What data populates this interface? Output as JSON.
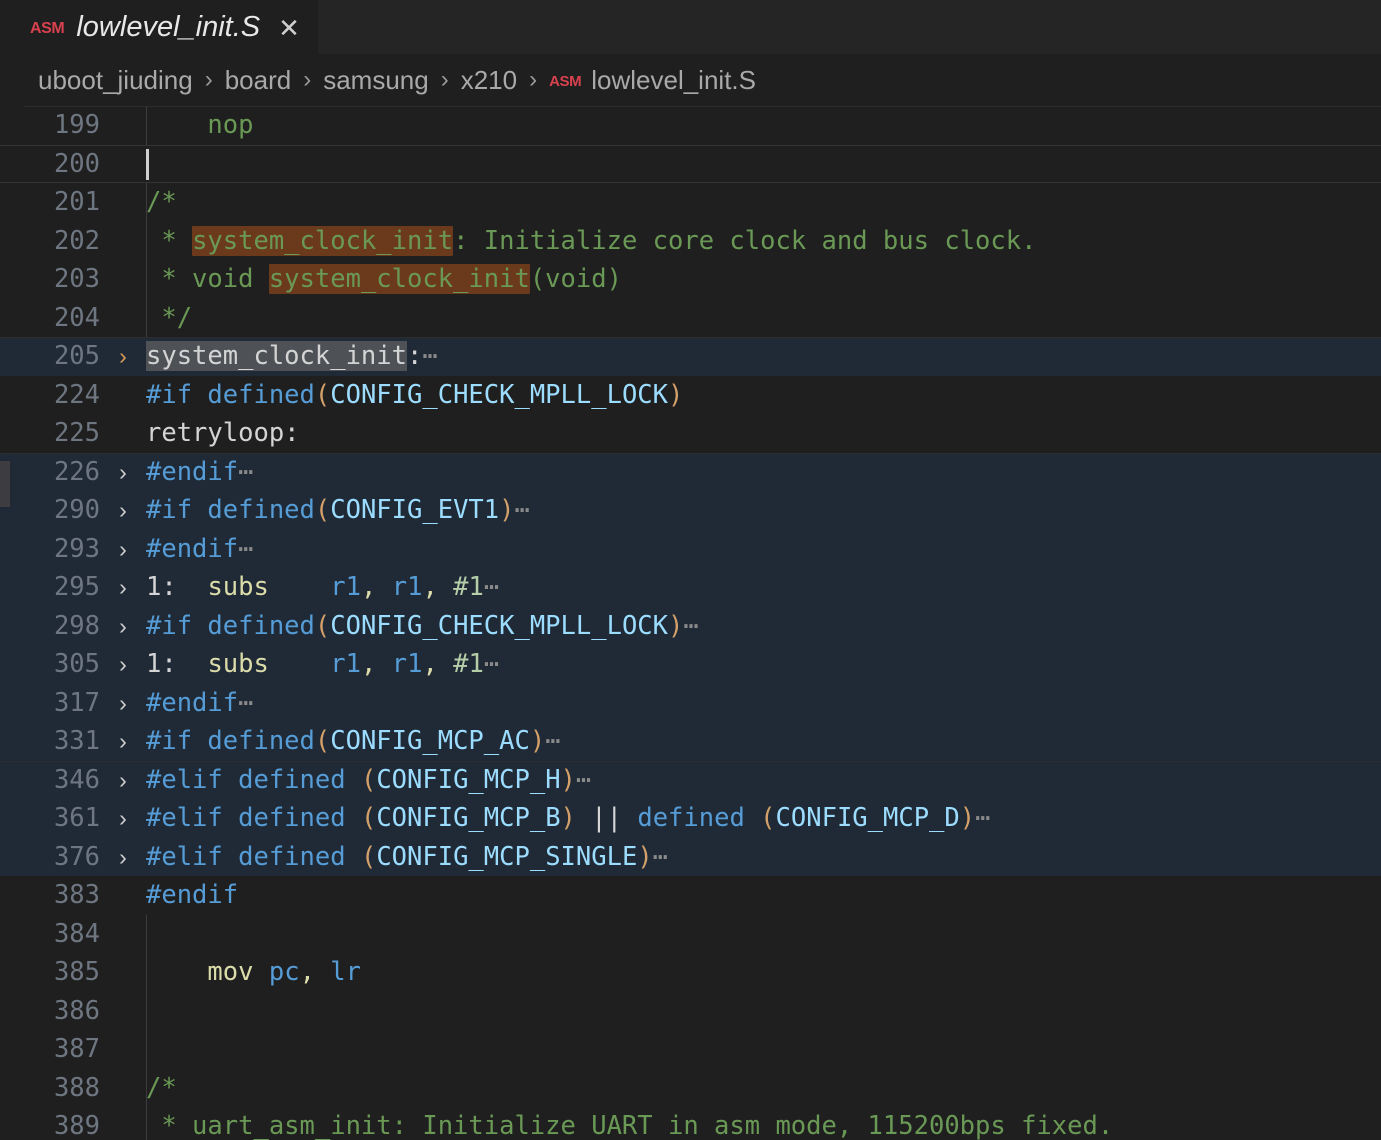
{
  "window": {
    "background": "#1f1f1f"
  },
  "tab": {
    "icon": "ASM",
    "icon_name": "asm-file-icon",
    "label": "lowlevel_init.S",
    "close": "✕",
    "active": true
  },
  "breadcrumb": {
    "separator": "›",
    "items": [
      {
        "label": "uboot_jiuding"
      },
      {
        "label": "board"
      },
      {
        "label": "samsung"
      },
      {
        "label": "x210"
      }
    ],
    "file": {
      "icon": "ASM",
      "label": "lowlevel_init.S"
    }
  },
  "colors": {
    "editor_background": "#1f1f1f",
    "tabbar_background": "#252526",
    "folded_region_background": "#1f2a36",
    "search_match_highlight": "#6b3a1c",
    "selection_highlight": "#4e5257",
    "line_number": "#6e7681",
    "comment": "#6a9955",
    "preprocessor": "#569cd6",
    "macro_name": "#9cdcfe",
    "instruction": "#dcdcaa",
    "register": "#569cd6",
    "number": "#b5cea8",
    "fold_chevron_active": "#d99a57",
    "asm_icon": "#d9414f"
  },
  "editor": {
    "fold_chevron": "›",
    "ellipsis": "⋯",
    "lines": [
      {
        "number": "199",
        "fold": false,
        "folded_bg": false,
        "current": false,
        "indent_guide": true,
        "tokens": [
          {
            "text": "    nop",
            "cls": "t-comment"
          }
        ]
      },
      {
        "number": "200",
        "fold": false,
        "folded_bg": false,
        "current": true,
        "indent_guide": false,
        "cursor": true,
        "tokens": []
      },
      {
        "number": "201",
        "fold": false,
        "folded_bg": false,
        "current": false,
        "indent_guide": true,
        "tokens": [
          {
            "text": "/*",
            "cls": "t-comment"
          }
        ]
      },
      {
        "number": "202",
        "fold": false,
        "folded_bg": false,
        "current": false,
        "indent_guide": true,
        "tokens": [
          {
            "text": " * ",
            "cls": "t-comment"
          },
          {
            "text": "system_clock_init",
            "cls": "t-comment",
            "hl": "match"
          },
          {
            "text": ": Initialize core clock and bus clock.",
            "cls": "t-comment"
          }
        ]
      },
      {
        "number": "203",
        "fold": false,
        "folded_bg": false,
        "current": false,
        "indent_guide": true,
        "tokens": [
          {
            "text": " * void ",
            "cls": "t-comment"
          },
          {
            "text": "system_clock_init",
            "cls": "t-comment",
            "hl": "match"
          },
          {
            "text": "(void)",
            "cls": "t-comment"
          }
        ]
      },
      {
        "number": "204",
        "fold": false,
        "folded_bg": false,
        "current": false,
        "indent_guide": true,
        "tokens": [
          {
            "text": " */",
            "cls": "t-comment"
          }
        ]
      },
      {
        "number": "205",
        "fold": true,
        "fold_accent": true,
        "folded_bg": true,
        "fold_top": true,
        "current": false,
        "indent_guide": false,
        "tokens": [
          {
            "text": "system_clock_init",
            "cls": "t-plain",
            "hl": "sel"
          },
          {
            "text": ":",
            "cls": "t-plain"
          },
          {
            "text": "⋯",
            "cls": "t-ell"
          }
        ]
      },
      {
        "number": "224",
        "fold": false,
        "folded_bg": false,
        "current": false,
        "indent_guide": false,
        "tokens": [
          {
            "text": "#if",
            "cls": "t-pre"
          },
          {
            "text": " ",
            "cls": "t-plain"
          },
          {
            "text": "defined",
            "cls": "t-pre"
          },
          {
            "text": "(",
            "cls": "t-paren"
          },
          {
            "text": "CONFIG_CHECK_MPLL_LOCK",
            "cls": "t-macro"
          },
          {
            "text": ")",
            "cls": "t-paren"
          }
        ]
      },
      {
        "number": "225",
        "fold": false,
        "folded_bg": false,
        "current": false,
        "indent_guide": false,
        "tokens": [
          {
            "text": "retryloop:",
            "cls": "t-plain"
          }
        ]
      },
      {
        "number": "226",
        "fold": true,
        "folded_bg": true,
        "fold_top": true,
        "current": false,
        "indent_guide": false,
        "tokens": [
          {
            "text": "#endif",
            "cls": "t-pre"
          },
          {
            "text": "⋯",
            "cls": "t-ell"
          }
        ]
      },
      {
        "number": "290",
        "fold": true,
        "folded_bg": true,
        "current": false,
        "indent_guide": false,
        "tokens": [
          {
            "text": "#if",
            "cls": "t-pre"
          },
          {
            "text": " ",
            "cls": "t-plain"
          },
          {
            "text": "defined",
            "cls": "t-pre"
          },
          {
            "text": "(",
            "cls": "t-paren"
          },
          {
            "text": "CONFIG_EVT1",
            "cls": "t-macro"
          },
          {
            "text": ")",
            "cls": "t-paren"
          },
          {
            "text": "⋯",
            "cls": "t-ell"
          }
        ]
      },
      {
        "number": "293",
        "fold": true,
        "folded_bg": true,
        "current": false,
        "indent_guide": false,
        "tokens": [
          {
            "text": "#endif",
            "cls": "t-pre"
          },
          {
            "text": "⋯",
            "cls": "t-ell"
          }
        ]
      },
      {
        "number": "295",
        "fold": true,
        "folded_bg": true,
        "current": false,
        "indent_guide": false,
        "tokens": [
          {
            "text": "1:",
            "cls": "t-plain"
          },
          {
            "text": "  ",
            "cls": "t-plain"
          },
          {
            "text": "subs",
            "cls": "t-instr"
          },
          {
            "text": "    ",
            "cls": "t-plain"
          },
          {
            "text": "r1",
            "cls": "t-reg"
          },
          {
            "text": ", ",
            "cls": "t-op"
          },
          {
            "text": "r1",
            "cls": "t-reg"
          },
          {
            "text": ", ",
            "cls": "t-op"
          },
          {
            "text": "#1",
            "cls": "t-num"
          },
          {
            "text": "⋯",
            "cls": "t-ell"
          }
        ]
      },
      {
        "number": "298",
        "fold": true,
        "folded_bg": true,
        "current": false,
        "indent_guide": false,
        "tokens": [
          {
            "text": "#if",
            "cls": "t-pre"
          },
          {
            "text": " ",
            "cls": "t-plain"
          },
          {
            "text": "defined",
            "cls": "t-pre"
          },
          {
            "text": "(",
            "cls": "t-paren"
          },
          {
            "text": "CONFIG_CHECK_MPLL_LOCK",
            "cls": "t-macro"
          },
          {
            "text": ")",
            "cls": "t-paren"
          },
          {
            "text": "⋯",
            "cls": "t-ell"
          }
        ]
      },
      {
        "number": "305",
        "fold": true,
        "folded_bg": true,
        "current": false,
        "indent_guide": false,
        "tokens": [
          {
            "text": "1:",
            "cls": "t-plain"
          },
          {
            "text": "  ",
            "cls": "t-plain"
          },
          {
            "text": "subs",
            "cls": "t-instr"
          },
          {
            "text": "    ",
            "cls": "t-plain"
          },
          {
            "text": "r1",
            "cls": "t-reg"
          },
          {
            "text": ", ",
            "cls": "t-op"
          },
          {
            "text": "r1",
            "cls": "t-reg"
          },
          {
            "text": ", ",
            "cls": "t-op"
          },
          {
            "text": "#1",
            "cls": "t-num"
          },
          {
            "text": "⋯",
            "cls": "t-ell"
          }
        ]
      },
      {
        "number": "317",
        "fold": true,
        "folded_bg": true,
        "current": false,
        "indent_guide": false,
        "tokens": [
          {
            "text": "#endif",
            "cls": "t-pre"
          },
          {
            "text": "⋯",
            "cls": "t-ell"
          }
        ]
      },
      {
        "number": "331",
        "fold": true,
        "folded_bg": true,
        "current": false,
        "indent_guide": false,
        "tokens": [
          {
            "text": "#if",
            "cls": "t-pre"
          },
          {
            "text": " ",
            "cls": "t-plain"
          },
          {
            "text": "defined",
            "cls": "t-pre"
          },
          {
            "text": "(",
            "cls": "t-paren"
          },
          {
            "text": "CONFIG_MCP_AC",
            "cls": "t-macro"
          },
          {
            "text": ")",
            "cls": "t-paren"
          },
          {
            "text": "⋯",
            "cls": "t-ell"
          }
        ]
      },
      {
        "number": "346",
        "fold": true,
        "folded_bg": true,
        "fold_top": true,
        "current": false,
        "indent_guide": false,
        "tokens": [
          {
            "text": "#elif",
            "cls": "t-pre"
          },
          {
            "text": " ",
            "cls": "t-plain"
          },
          {
            "text": "defined",
            "cls": "t-pre"
          },
          {
            "text": " ",
            "cls": "t-plain"
          },
          {
            "text": "(",
            "cls": "t-paren"
          },
          {
            "text": "CONFIG_MCP_H",
            "cls": "t-macro"
          },
          {
            "text": ")",
            "cls": "t-paren"
          },
          {
            "text": "⋯",
            "cls": "t-ell"
          }
        ]
      },
      {
        "number": "361",
        "fold": true,
        "folded_bg": true,
        "current": false,
        "indent_guide": false,
        "tokens": [
          {
            "text": "#elif",
            "cls": "t-pre"
          },
          {
            "text": " ",
            "cls": "t-plain"
          },
          {
            "text": "defined",
            "cls": "t-pre"
          },
          {
            "text": " ",
            "cls": "t-plain"
          },
          {
            "text": "(",
            "cls": "t-paren"
          },
          {
            "text": "CONFIG_MCP_B",
            "cls": "t-macro"
          },
          {
            "text": ")",
            "cls": "t-paren"
          },
          {
            "text": " ",
            "cls": "t-plain"
          },
          {
            "text": "||",
            "cls": "t-plain"
          },
          {
            "text": " ",
            "cls": "t-plain"
          },
          {
            "text": "defined",
            "cls": "t-pre"
          },
          {
            "text": " ",
            "cls": "t-plain"
          },
          {
            "text": "(",
            "cls": "t-paren"
          },
          {
            "text": "CONFIG_MCP_D",
            "cls": "t-macro"
          },
          {
            "text": ")",
            "cls": "t-paren"
          },
          {
            "text": "⋯",
            "cls": "t-ell"
          }
        ]
      },
      {
        "number": "376",
        "fold": true,
        "folded_bg": true,
        "current": false,
        "indent_guide": false,
        "tokens": [
          {
            "text": "#elif",
            "cls": "t-pre"
          },
          {
            "text": " ",
            "cls": "t-plain"
          },
          {
            "text": "defined",
            "cls": "t-pre"
          },
          {
            "text": " ",
            "cls": "t-plain"
          },
          {
            "text": "(",
            "cls": "t-paren"
          },
          {
            "text": "CONFIG_MCP_SINGLE",
            "cls": "t-macro"
          },
          {
            "text": ")",
            "cls": "t-paren"
          },
          {
            "text": "⋯",
            "cls": "t-ell"
          }
        ]
      },
      {
        "number": "383",
        "fold": false,
        "folded_bg": false,
        "current": false,
        "indent_guide": false,
        "tokens": [
          {
            "text": "#endif",
            "cls": "t-pre"
          }
        ]
      },
      {
        "number": "384",
        "fold": false,
        "folded_bg": false,
        "current": false,
        "indent_guide": true,
        "tokens": []
      },
      {
        "number": "385",
        "fold": false,
        "folded_bg": false,
        "current": false,
        "indent_guide": true,
        "tokens": [
          {
            "text": "    ",
            "cls": "t-plain"
          },
          {
            "text": "mov",
            "cls": "t-instr"
          },
          {
            "text": " ",
            "cls": "t-plain"
          },
          {
            "text": "pc",
            "cls": "t-reg"
          },
          {
            "text": ", ",
            "cls": "t-op"
          },
          {
            "text": "lr",
            "cls": "t-reg"
          }
        ]
      },
      {
        "number": "386",
        "fold": false,
        "folded_bg": false,
        "current": false,
        "indent_guide": true,
        "tokens": []
      },
      {
        "number": "387",
        "fold": false,
        "folded_bg": false,
        "current": false,
        "indent_guide": true,
        "tokens": []
      },
      {
        "number": "388",
        "fold": false,
        "folded_bg": false,
        "current": false,
        "indent_guide": true,
        "tokens": [
          {
            "text": "/*",
            "cls": "t-comment"
          }
        ]
      },
      {
        "number": "389",
        "fold": false,
        "folded_bg": false,
        "current": false,
        "indent_guide": true,
        "tokens": [
          {
            "text": " * uart_asm_init: Initialize UART in asm mode, 115200bps fixed.",
            "cls": "t-comment"
          }
        ]
      }
    ]
  }
}
